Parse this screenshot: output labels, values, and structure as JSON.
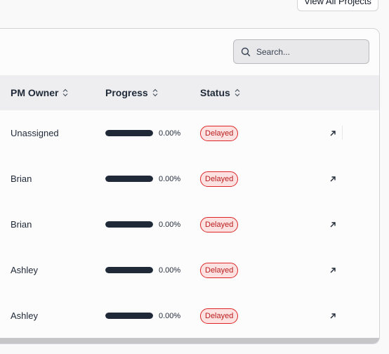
{
  "header": {
    "view_all_label": "View All Projects"
  },
  "search": {
    "placeholder": "Search..."
  },
  "table": {
    "columns": [
      "PM Owner",
      "Progress",
      "Status"
    ],
    "rows": [
      {
        "owner": "Unassigned",
        "progress": 0.0,
        "progress_label": "0.00%",
        "status": "Delayed"
      },
      {
        "owner": "Brian",
        "progress": 0.0,
        "progress_label": "0.00%",
        "status": "Delayed"
      },
      {
        "owner": "Brian",
        "progress": 0.0,
        "progress_label": "0.00%",
        "status": "Delayed"
      },
      {
        "owner": "Ashley",
        "progress": 0.0,
        "progress_label": "0.00%",
        "status": "Delayed"
      },
      {
        "owner": "Ashley",
        "progress": 0.0,
        "progress_label": "0.00%",
        "status": "Delayed"
      }
    ]
  },
  "icons": {
    "search": "search-icon",
    "sort": "sort-icon",
    "open": "arrow-up-right-icon"
  },
  "colors": {
    "status_delayed_text": "#b91c1c",
    "status_delayed_bg": "#fee2e2",
    "progress_bar": "#1f2937"
  }
}
